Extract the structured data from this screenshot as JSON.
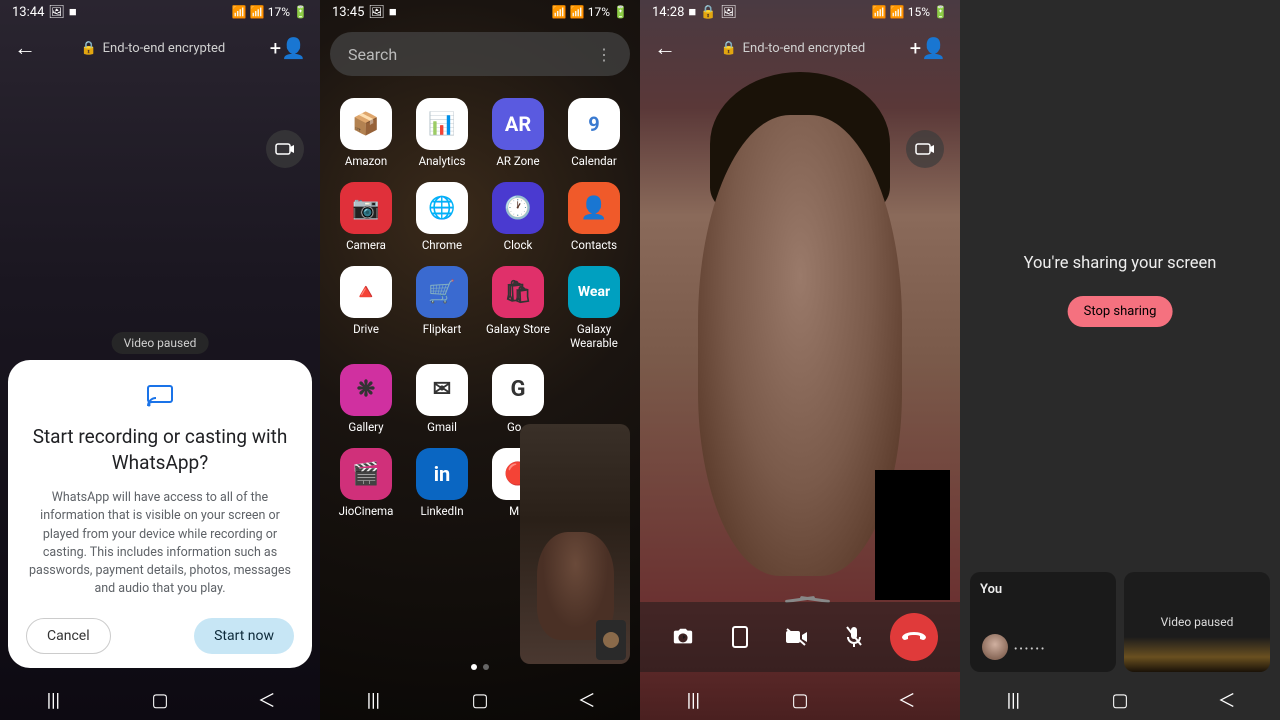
{
  "panel1": {
    "status": {
      "time": "13:44",
      "battery": "17%"
    },
    "header": {
      "encrypted": "End-to-end encrypted"
    },
    "video_paused": "Video paused",
    "dialog": {
      "title": "Start recording or casting with WhatsApp?",
      "body": "WhatsApp will have access to all of the information that is visible on your screen or played from your device while recording or casting. This includes information such as passwords, payment details, photos, messages and audio that you play.",
      "cancel": "Cancel",
      "start": "Start now"
    }
  },
  "panel2": {
    "status": {
      "time": "13:45",
      "battery": "17%"
    },
    "search_placeholder": "Search",
    "apps": [
      {
        "label": "Amazon",
        "bg": "#fff",
        "emoji": "📦"
      },
      {
        "label": "Analytics",
        "bg": "#fff",
        "emoji": "📊"
      },
      {
        "label": "AR Zone",
        "bg": "#5a5ae0",
        "text": "AR",
        "fg": "#fff"
      },
      {
        "label": "Calendar",
        "bg": "#fff",
        "text": "9",
        "fg": "#3a7ad0"
      },
      {
        "label": "Camera",
        "bg": "#e0303a",
        "emoji": "📷"
      },
      {
        "label": "Chrome",
        "bg": "#fff",
        "emoji": "🌐"
      },
      {
        "label": "Clock",
        "bg": "#4a3ad0",
        "emoji": "🕐"
      },
      {
        "label": "Contacts",
        "bg": "#f05a2a",
        "emoji": "👤"
      },
      {
        "label": "Drive",
        "bg": "#fff",
        "emoji": "🔺"
      },
      {
        "label": "Flipkart",
        "bg": "#3a6ad0",
        "emoji": "🛒"
      },
      {
        "label": "Galaxy Store",
        "bg": "#e0306a",
        "emoji": "🛍"
      },
      {
        "label": "Galaxy Wearable",
        "bg": "#00a0c0",
        "text": "Wear",
        "fg": "#fff"
      },
      {
        "label": "Gallery",
        "bg": "#d030a0",
        "emoji": "❋"
      },
      {
        "label": "Gmail",
        "bg": "#fff",
        "emoji": "✉"
      },
      {
        "label": "Go…",
        "bg": "#fff",
        "emoji": "G"
      },
      {
        "label": ""
      },
      {
        "label": "JioCinema",
        "bg": "#d0307a",
        "emoji": "🎬"
      },
      {
        "label": "LinkedIn",
        "bg": "#0a66c2",
        "text": "in",
        "fg": "#fff"
      },
      {
        "label": "M…",
        "bg": "#fff",
        "emoji": "🔴"
      }
    ]
  },
  "panel3": {
    "status": {
      "time": "14:28",
      "battery": "15%"
    },
    "header": {
      "encrypted": "End-to-end encrypted"
    }
  },
  "panel4": {
    "sharing_msg": "You're sharing your screen",
    "stop_label": "Stop sharing",
    "card_you": "You",
    "card_dots": "••••••",
    "video_paused": "Video paused"
  }
}
